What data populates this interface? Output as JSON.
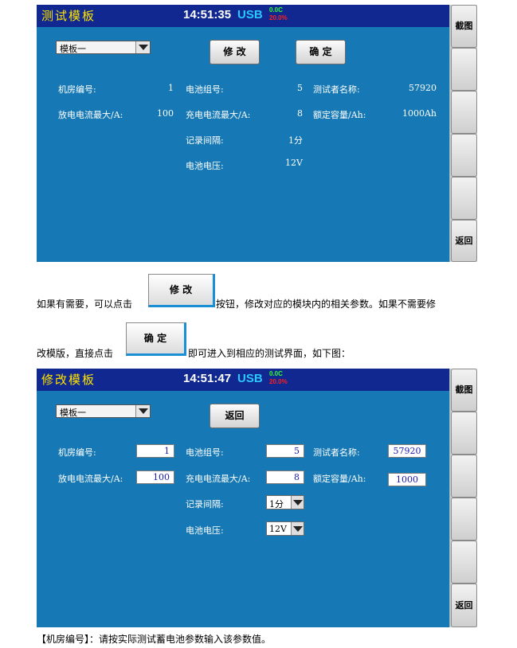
{
  "screen1": {
    "title": "测试模板",
    "clock": "14:51:35",
    "usb": "USB",
    "indicator_top": "0.0C",
    "indicator_bottom": "20.0%",
    "template_select": "模板一",
    "modify_button": "修 改",
    "confirm_button": "确 定",
    "sidebar": [
      "截图",
      "",
      "",
      "",
      "",
      "返回"
    ],
    "fields": {
      "room_no_label": "机房编号:",
      "room_no_value": "1",
      "group_label": "电池组号:",
      "group_value": "5",
      "tester_label": "测试者名称:",
      "tester_value": "57920",
      "discharge_label": "放电电流最大/A:",
      "discharge_value": "100",
      "charge_label": "充电电流最大/A:",
      "charge_value": "8",
      "capacity_label": "额定容量/Ah:",
      "capacity_value": "1000Ah",
      "interval_label": "记录间隔:",
      "interval_value": "1分",
      "voltage_label": "电池电压:",
      "voltage_value": "12V"
    }
  },
  "paragraph": {
    "line1_before": "如果有需要，可以点击",
    "line1_button": "修 改",
    "line1_after": "按钮，修改对应的模块内的相关参数。如果不需要修",
    "line2_before": "改模版，直接点击",
    "line2_button": "确 定",
    "line2_after": "即可进入到相应的测试界面，如下图："
  },
  "screen2": {
    "title": "修改模板",
    "clock": "14:51:47",
    "usb": "USB",
    "indicator_top": "0.0C",
    "indicator_bottom": "20.0%",
    "template_select": "模板一",
    "back_button": "返回",
    "sidebar": [
      "截图",
      "",
      "",
      "",
      "",
      "返回"
    ],
    "fields": {
      "room_no_label": "机房编号:",
      "room_no_value": "1",
      "group_label": "电池组号:",
      "group_value": "5",
      "tester_label": "测试者名称:",
      "tester_value": "57920",
      "discharge_label": "放电电流最大/A:",
      "discharge_value": "100",
      "charge_label": "充电电流最大/A:",
      "charge_value": "8",
      "capacity_label": "额定容量/Ah:",
      "capacity_value": "1000",
      "interval_label": "记录间隔:",
      "interval_value": "1分",
      "voltage_label": "电池电压:",
      "voltage_value": "12V"
    }
  },
  "footer_note": "【机房编号】：请按实际测试蓄电池参数输入该参数值。"
}
